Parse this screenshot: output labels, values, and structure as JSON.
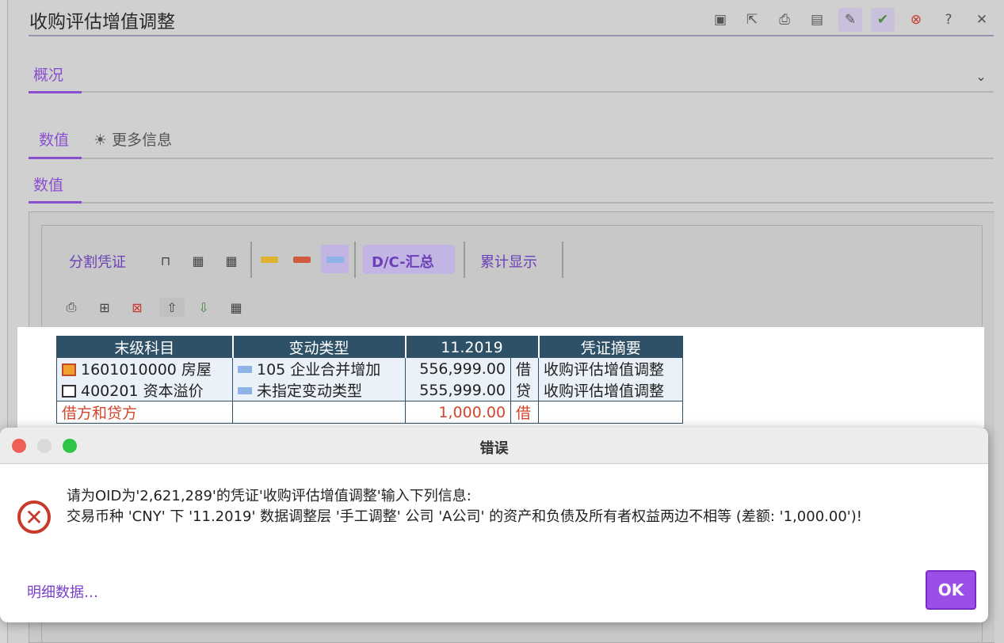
{
  "window": {
    "title": "收购评估增值调整"
  },
  "toolbar": {
    "icons": [
      "window-icon",
      "external-link-icon",
      "print-icon",
      "save-icon",
      "edit-icon",
      "check-circle-icon",
      "cancel-circle-icon",
      "help-icon",
      "close-icon"
    ]
  },
  "tabs": {
    "overview": "概况",
    "values_tab": "数值",
    "more_info": "更多信息",
    "values_section": "数值"
  },
  "panel_toolbar": {
    "split_voucher": "分割凭证",
    "dc_summary": "D/C-汇总",
    "cumulative": "累计显示",
    "colors": {
      "yellow": "#e0b030",
      "red": "#d05a40",
      "blue": "#8cb4e8"
    }
  },
  "grid": {
    "headers": [
      "末级科目",
      "变动类型",
      "11.2019",
      "凭证摘要"
    ],
    "rows": [
      {
        "account": "1601010000 房屋",
        "change_type": "105 企业合并增加",
        "amount": "556,999.00",
        "dc": "借",
        "summary": "收购评估增值调整"
      },
      {
        "account": "400201 资本溢价",
        "change_type": "未指定变动类型",
        "amount": "555,999.00",
        "dc": "贷",
        "summary": "收购评估增值调整"
      }
    ],
    "total": {
      "label": "借方和贷方",
      "amount": "1,000.00",
      "dc": "借"
    }
  },
  "dialog": {
    "title": "错误",
    "line1": "请为OID为'2,621,289'的凭证'收购评估增值调整'输入下列信息:",
    "line2": "交易币种 'CNY' 下 '11.2019' 数据调整层 '手工调整' 公司 'A公司' 的资产和负债及所有者权益两边不相等 (差额:  '1,000.00')!",
    "details_link": "明细数据…",
    "ok_label": "OK"
  }
}
